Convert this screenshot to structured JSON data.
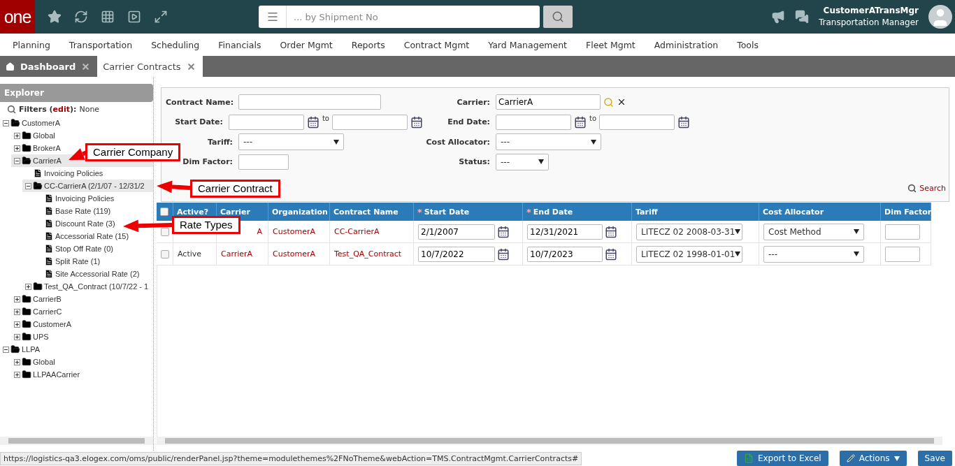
{
  "header": {
    "logo": "one",
    "search": {
      "placeholder": "... by Shipment No"
    },
    "user": {
      "name": "CustomerATransMgr",
      "role": "Transportation Manager"
    }
  },
  "menu": [
    "Planning",
    "Transportation",
    "Scheduling",
    "Financials",
    "Order Mgmt",
    "Reports",
    "Contract Mgmt",
    "Yard Management",
    "Fleet Mgmt",
    "Administration",
    "Tools"
  ],
  "tabs": [
    {
      "label": "Dashboard",
      "selected": false
    },
    {
      "label": "Carrier Contracts",
      "selected": true
    }
  ],
  "explorer": {
    "title": "Explorer",
    "filters_prefix": "Filters (",
    "filters_edit": "edit",
    "filters_suffix": "):",
    "filters_value": "None",
    "tree": [
      {
        "label": "CustomerA",
        "kind": "folder",
        "expanded": true,
        "selected": false,
        "children": [
          {
            "label": "Global",
            "kind": "folder",
            "expanded": false,
            "selected": false
          },
          {
            "label": "BrokerA",
            "kind": "folder",
            "expanded": false,
            "selected": false
          },
          {
            "label": "CarrierA",
            "kind": "folder",
            "expanded": true,
            "selected": true,
            "children": [
              {
                "label": "Invoicing Policies",
                "kind": "doc",
                "selected": false
              },
              {
                "label": "CC-CarrierA (2/1/07 - 12/31/2",
                "kind": "folder",
                "expanded": true,
                "selected": true,
                "children": [
                  {
                    "label": "Invoicing Policies",
                    "kind": "doc",
                    "selected": false
                  },
                  {
                    "label": "Base Rate (119)",
                    "kind": "doc",
                    "selected": false
                  },
                  {
                    "label": "Discount Rate (3)",
                    "kind": "doc",
                    "selected": false
                  },
                  {
                    "label": "Accessorial Rate (15)",
                    "kind": "doc",
                    "selected": false
                  },
                  {
                    "label": "Stop Off Rate (0)",
                    "kind": "doc",
                    "selected": false
                  },
                  {
                    "label": "Split Rate (1)",
                    "kind": "doc",
                    "selected": false
                  },
                  {
                    "label": "Site Accessorial Rate (2)",
                    "kind": "doc",
                    "selected": false
                  }
                ]
              },
              {
                "label": "Test_QA_Contract (10/7/22 - 1",
                "kind": "folder",
                "expanded": false,
                "selected": false
              }
            ]
          },
          {
            "label": "CarrierB",
            "kind": "folder",
            "expanded": false,
            "selected": false
          },
          {
            "label": "CarrierC",
            "kind": "folder",
            "expanded": false,
            "selected": false
          },
          {
            "label": "CustomerA",
            "kind": "folder",
            "expanded": false,
            "selected": false
          },
          {
            "label": "UPS",
            "kind": "folder",
            "expanded": false,
            "selected": false
          }
        ]
      },
      {
        "label": "LLPA",
        "kind": "folder",
        "expanded": true,
        "selected": false,
        "children": [
          {
            "label": "Global",
            "kind": "folder",
            "expanded": false,
            "selected": false
          },
          {
            "label": "LLPAACarrier",
            "kind": "folder",
            "expanded": false,
            "selected": false
          }
        ]
      }
    ]
  },
  "filters": {
    "left": [
      {
        "label": "Contract Name:",
        "kind": "text"
      },
      {
        "label": "Start Date:",
        "kind": "daterange",
        "to": "to"
      },
      {
        "label": "Tariff:",
        "kind": "select",
        "value": "---"
      },
      {
        "label": "Dim Factor:",
        "kind": "short"
      }
    ],
    "right": [
      {
        "label": "Carrier:",
        "kind": "lookup",
        "value": "CarrierA"
      },
      {
        "label": "End Date:",
        "kind": "daterange",
        "to": "to"
      },
      {
        "label": "Cost Allocator:",
        "kind": "select",
        "value": "---"
      },
      {
        "label": "Status:",
        "kind": "shortselect",
        "value": "---"
      }
    ],
    "search": "Search"
  },
  "table": {
    "all_checked": false,
    "required_mark": "*",
    "columns": [
      {
        "label": "Active?",
        "required": false
      },
      {
        "label": "Carrier",
        "required": false
      },
      {
        "label": "Organization",
        "required": false
      },
      {
        "label": "Contract Name",
        "required": false
      },
      {
        "label": "Start Date",
        "required": true
      },
      {
        "label": "End Date",
        "required": true
      },
      {
        "label": "Tariff",
        "required": false
      },
      {
        "label": "Cost Allocator",
        "required": false
      },
      {
        "label": "Dim Factor",
        "required": false
      }
    ],
    "rows": [
      {
        "checked": false,
        "carrier": "A",
        "organization": "CustomerA",
        "contract": "CC-CarrierA",
        "start": "2/1/2007",
        "end": "12/31/2021",
        "tariff": "LITECZ 02 2008-03-31",
        "cost_allocator": "Cost Method"
      },
      {
        "checked": false,
        "active": "Active",
        "carrier": "CarrierA",
        "organization": "CustomerA",
        "contract": "Test_QA_Contract",
        "start": "10/7/2022",
        "end": "10/7/2023",
        "tariff": "LITECZ 02 1998-01-01",
        "cost_allocator": "---"
      }
    ]
  },
  "callouts": [
    "Carrier Company",
    "Carrier Contract",
    "Rate Types"
  ],
  "status_url": "https://logistics-qa3.elogex.com/oms/public/renderPanel.jsp?theme=modulethemes%2FNoTheme&webAction=TMS.ContractMgmt.CarrierContracts#",
  "buttons": [
    {
      "label": "Export to Excel",
      "kind": "excel"
    },
    {
      "label": "Actions",
      "kind": "menu"
    },
    {
      "label": "Save",
      "kind": "plain"
    }
  ]
}
